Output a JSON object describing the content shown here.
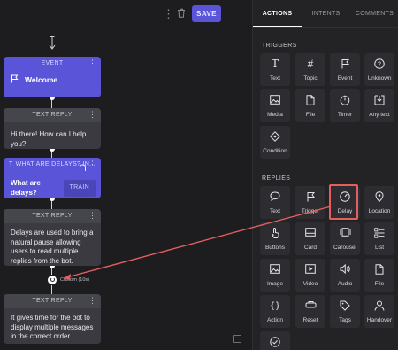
{
  "toolbar": {
    "save_label": "SAVE"
  },
  "flow": {
    "event_card": {
      "header": "EVENT",
      "title": "Welcome"
    },
    "reply1": {
      "header": "TEXT REPLY",
      "text": "Hi there! How can I help you?"
    },
    "intent_card": {
      "header": "WHAT ARE DELAYS? IN...",
      "title": "What are delays?",
      "train_label": "TRAIN"
    },
    "reply2": {
      "header": "TEXT REPLY",
      "text": "Delays are used to bring a natural pause allowing users to read multiple replies from the bot."
    },
    "delay": {
      "label": "Custom (10s)"
    },
    "reply3": {
      "header": "TEXT REPLY",
      "text": "It gives time for the bot to display multiple messages in the correct order"
    }
  },
  "panel": {
    "tabs": [
      "ACTIONS",
      "INTENTS",
      "COMMENTS"
    ],
    "active_tab": "ACTIONS",
    "triggers_label": "TRIGGERS",
    "triggers": [
      {
        "label": "Text",
        "icon": "text-icon"
      },
      {
        "label": "Topic",
        "icon": "hash-icon"
      },
      {
        "label": "Event",
        "icon": "flag-icon"
      },
      {
        "label": "Unknown",
        "icon": "question-icon"
      },
      {
        "label": "Media",
        "icon": "image-icon"
      },
      {
        "label": "File",
        "icon": "file-icon"
      },
      {
        "label": "Timer",
        "icon": "timer-icon"
      },
      {
        "label": "Any text",
        "icon": "download-icon"
      },
      {
        "label": "Condition",
        "icon": "diamond-icon"
      }
    ],
    "replies_label": "REPLIES",
    "replies": [
      {
        "label": "Text",
        "icon": "speech-bubble-icon"
      },
      {
        "label": "Trigger",
        "icon": "flag-icon"
      },
      {
        "label": "Delay",
        "icon": "clock-icon"
      },
      {
        "label": "Location",
        "icon": "location-pin-icon"
      },
      {
        "label": "Buttons",
        "icon": "pointer-icon"
      },
      {
        "label": "Card",
        "icon": "card-icon"
      },
      {
        "label": "Carousel",
        "icon": "carousel-icon"
      },
      {
        "label": "List",
        "icon": "list-icon"
      },
      {
        "label": "Image",
        "icon": "image-icon"
      },
      {
        "label": "Video",
        "icon": "video-icon"
      },
      {
        "label": "Audio",
        "icon": "speaker-icon"
      },
      {
        "label": "File",
        "icon": "file-icon"
      },
      {
        "label": "Action",
        "icon": "braces-icon"
      },
      {
        "label": "Reset",
        "icon": "reset-icon"
      },
      {
        "label": "Tags",
        "icon": "tag-icon"
      },
      {
        "label": "Handover",
        "icon": "handover-icon"
      },
      {
        "label": "",
        "icon": "check-circle-icon"
      }
    ]
  },
  "colors": {
    "accent": "#5a55d8",
    "highlight": "#e35e5e"
  }
}
